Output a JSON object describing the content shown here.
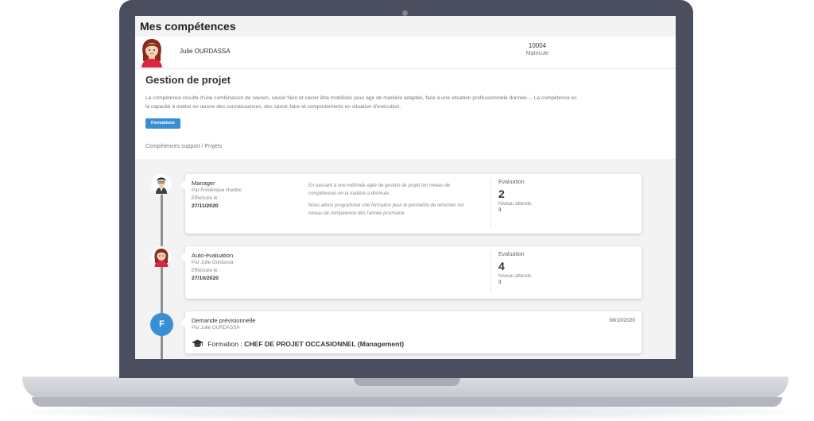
{
  "app": {
    "title": "Mes compétences"
  },
  "user": {
    "name": "Julie OURDASSA",
    "matricule_value": "10004",
    "matricule_label": "Matricule"
  },
  "competence": {
    "title": "Gestion de projet",
    "description_line1": "La compétence résulte d'une combinaison de savoirs, savoir faire et savoir être mobilisés pour agir de manière adaptée, face à une situation professionnelle donnée.... La compétence es",
    "description_line2": "la capacité à mettre en œuvre des connaissances, des savoir-faire et comportements en situation d'exécution.",
    "formations_button": "Formations",
    "breadcrumb": "Compétences support / Projets"
  },
  "timeline": [
    {
      "title": "Manager",
      "by": "Par Frédérique Huetter",
      "effectue_label": "Effectuée le :",
      "date": "27/11/2020",
      "comment_p1": "En passant à une méthode agile de gestion de projet ton niveau de compétences en la matière a diminuer.",
      "comment_p2": "Nous allons programmer une formation pour te permettre de remonter ton niveau de compétence dès l'année prochaine.",
      "eval_label": "Evaluation",
      "eval_value": "2",
      "niveau_label": "Niveau attendu",
      "niveau_value": "3"
    },
    {
      "title": "Auto-évaluation",
      "by": "Par Julie Ourdassa",
      "effectue_label": "Effectuée le :",
      "date": "27/10/2020",
      "eval_label": "Evaluation",
      "eval_value": "4",
      "niveau_label": "Niveau attendu",
      "niveau_value": "3"
    },
    {
      "avatar_letter": "F",
      "title": "Demande prévisionnelle",
      "by": "Par Julie OURDASSA",
      "date": "08/10/2020",
      "formation_label": "Formation :",
      "formation_value": "CHEF DE PROJET OCCASIONNEL (Management)"
    }
  ],
  "icons": {
    "formation": "graduation-cap-icon",
    "manager_avatar": "manager-avatar",
    "user_avatar": "user-avatar"
  },
  "colors": {
    "accent": "#3a8fd3",
    "bezel": "#4b4e5e",
    "timeline": "#8f8f8f"
  }
}
